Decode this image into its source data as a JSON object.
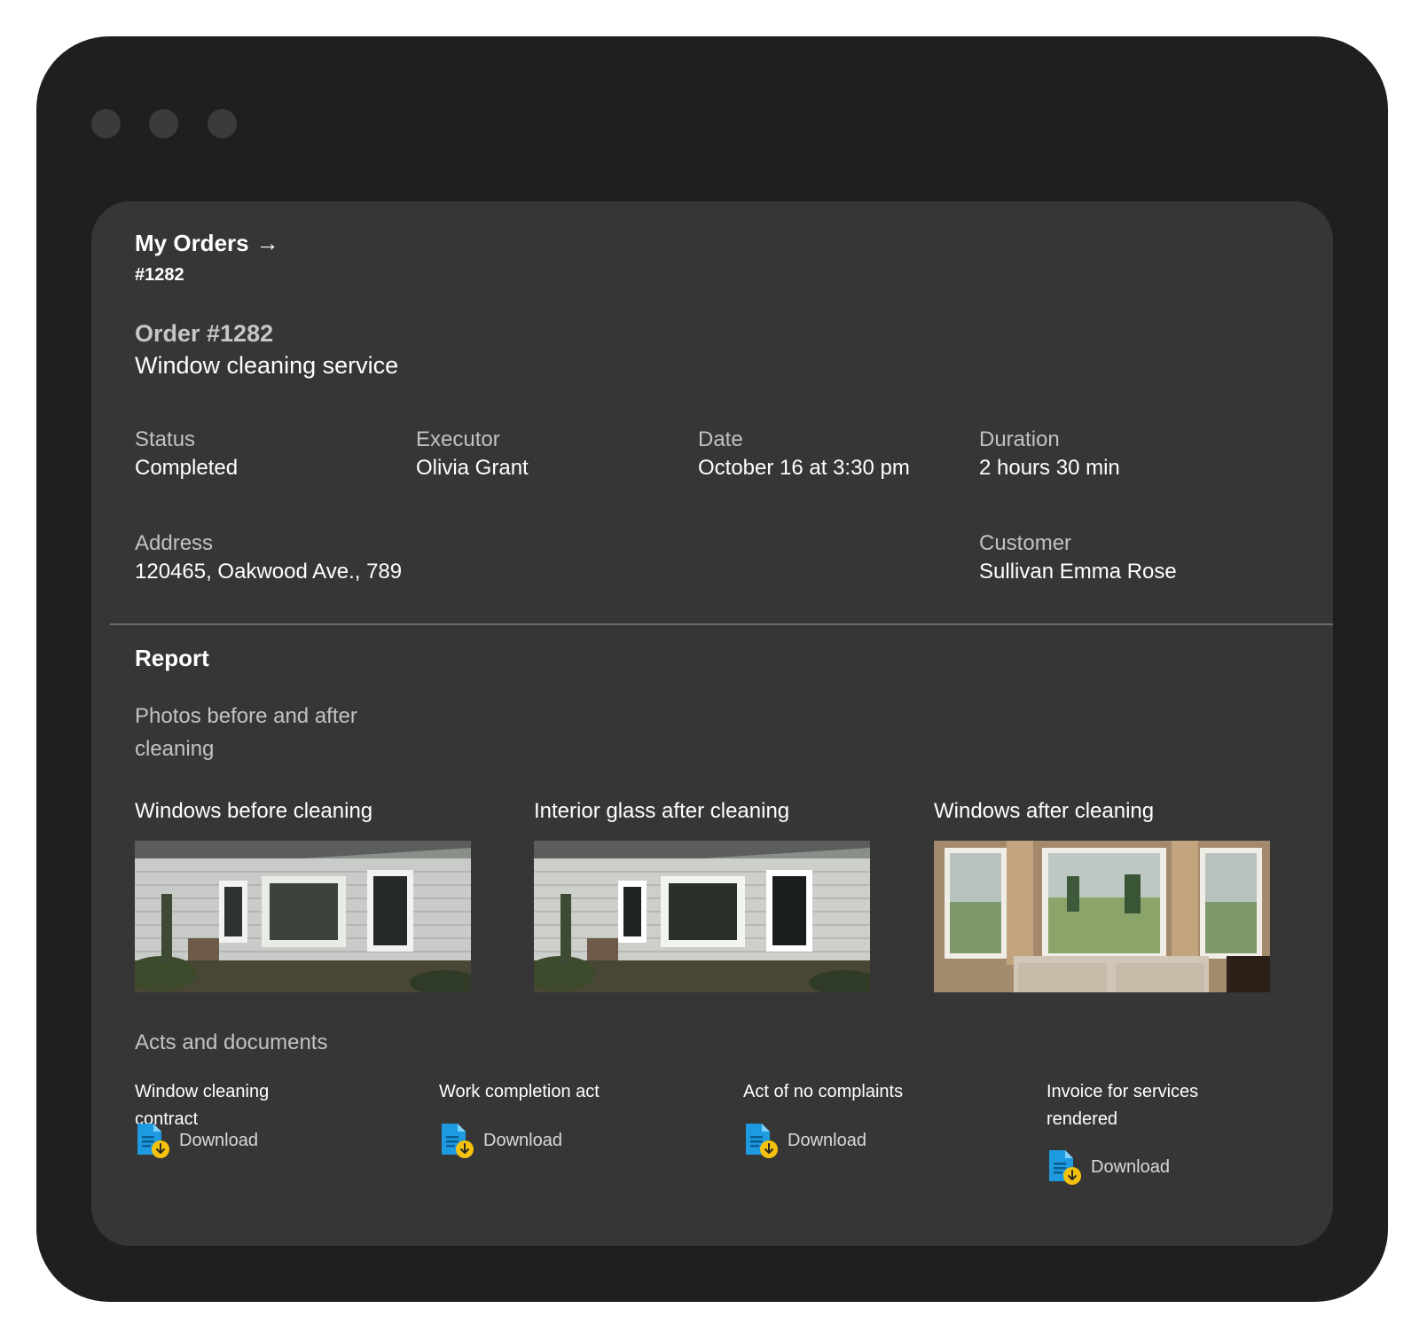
{
  "breadcrumb": {
    "title": "My Orders",
    "arrow": "→",
    "sub": "#1282"
  },
  "order": {
    "number": "Order #1282",
    "service": "Window cleaning service"
  },
  "details": {
    "status": {
      "label": "Status",
      "value": "Completed"
    },
    "executor": {
      "label": "Executor",
      "value": "Olivia Grant"
    },
    "date": {
      "label": "Date",
      "value": "October 16 at 3:30 pm"
    },
    "duration": {
      "label": "Duration",
      "value": "2 hours 30 min"
    },
    "address": {
      "label": "Address",
      "value": "120465, Oakwood Ave., 789"
    },
    "customer": {
      "label": "Customer",
      "value": "Sullivan Emma Rose"
    }
  },
  "report": {
    "title": "Report",
    "photos_title": "Photos before and after cleaning",
    "photos": [
      {
        "caption": "Windows before cleaning",
        "icon": "exterior-window-photo"
      },
      {
        "caption": "Interior glass after cleaning",
        "icon": "exterior-window-photo"
      },
      {
        "caption": "Windows after cleaning",
        "icon": "interior-window-photo"
      }
    ],
    "acts_title": "Acts and documents",
    "documents": [
      {
        "title": "Window cleaning contract",
        "action": "Download"
      },
      {
        "title": "Work completion act",
        "action": "Download"
      },
      {
        "title": "Act of no complaints",
        "action": "Download"
      },
      {
        "title": "Invoice for services rendered",
        "action": "Download"
      }
    ]
  },
  "colors": {
    "window_bg": "#1f1f1e",
    "card_bg": "#363636",
    "doc_icon_blue": "#1e9be0",
    "doc_icon_yellow": "#f4c20d"
  }
}
